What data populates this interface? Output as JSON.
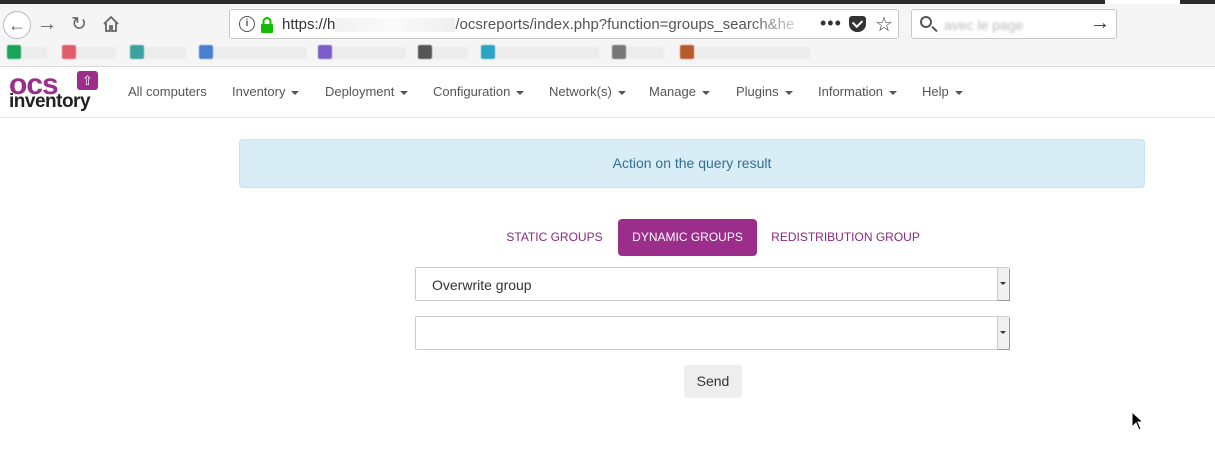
{
  "browser": {
    "url_prefix": "https://h",
    "url_visible": "/ocsreports/index.php?function=groups_search&he",
    "search_text": "avec le page",
    "overflow_label": "•••"
  },
  "bookmarks": [
    {
      "label": "",
      "color": "#1aa35a"
    },
    {
      "label": "",
      "color": "#e45b6b"
    },
    {
      "label": "",
      "color": "#3aa3a0"
    },
    {
      "label": "",
      "color": "#4a7fd0"
    },
    {
      "label": "",
      "color": "#7b5cc8"
    },
    {
      "label": "",
      "color": "#555555"
    },
    {
      "label": "",
      "color": "#2ba3c4"
    },
    {
      "label": "",
      "color": "#777777"
    },
    {
      "label": "",
      "color": "#b85a2a"
    }
  ],
  "brand": {
    "logo_top": "ocs",
    "logo_bottom": "inventory",
    "accent": "#9b2d8b"
  },
  "nav": {
    "items": [
      {
        "label": "All computers",
        "has_caret": false
      },
      {
        "label": "Inventory",
        "has_caret": true
      },
      {
        "label": "Deployment",
        "has_caret": true
      },
      {
        "label": "Configuration",
        "has_caret": true
      },
      {
        "label": "Network(s)",
        "has_caret": true
      },
      {
        "label": "Manage",
        "has_caret": true
      },
      {
        "label": "Plugins",
        "has_caret": true
      },
      {
        "label": "Information",
        "has_caret": true
      },
      {
        "label": "Help",
        "has_caret": true
      }
    ]
  },
  "main": {
    "alert_text": "Action on the query result",
    "tabs": [
      {
        "label": "STATIC GROUPS",
        "active": false
      },
      {
        "label": "DYNAMIC GROUPS",
        "active": true
      },
      {
        "label": "REDISTRIBUTION GROUP",
        "active": false
      }
    ],
    "action_select": {
      "value": "Overwrite group"
    },
    "group_select": {
      "value": ""
    },
    "send_label": "Send"
  }
}
